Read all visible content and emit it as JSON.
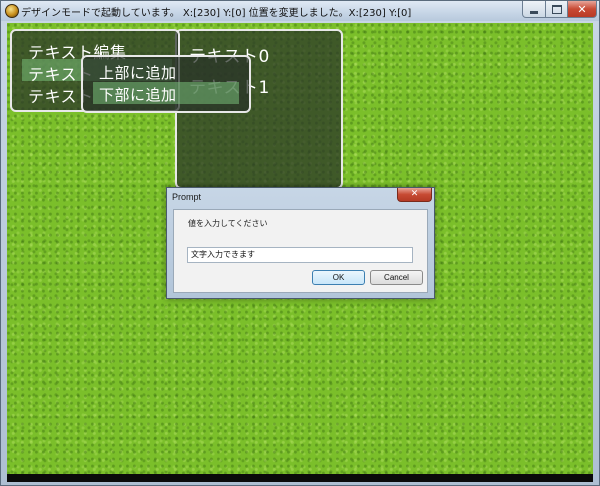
{
  "window": {
    "title": "デザインモードで起動しています。 X:[230] Y:[0] 位置を変更しました。X:[230] Y:[0]",
    "minimize_label": "",
    "maximize_label": "",
    "close_symbol": "✕"
  },
  "menu_window": {
    "items": [
      "テキスト編集",
      "テキスト",
      "テキスト"
    ],
    "selected_index": 1
  },
  "submenu_window": {
    "items": [
      "上部に追加",
      "下部に追加"
    ],
    "selected_index": 1
  },
  "text_window": {
    "items": [
      "テキスト0",
      "テキスト1"
    ]
  },
  "dialog": {
    "title": "Prompt",
    "close_symbol": "✕",
    "prompt": "値を入力してください",
    "input_value": "文字入力できます",
    "ok_label": "OK",
    "cancel_label": "Cancel"
  },
  "colors": {
    "grass": "#7bbf2a",
    "window_bg": "rgba(40,50,40,0.72)",
    "selection": "#78be78"
  }
}
